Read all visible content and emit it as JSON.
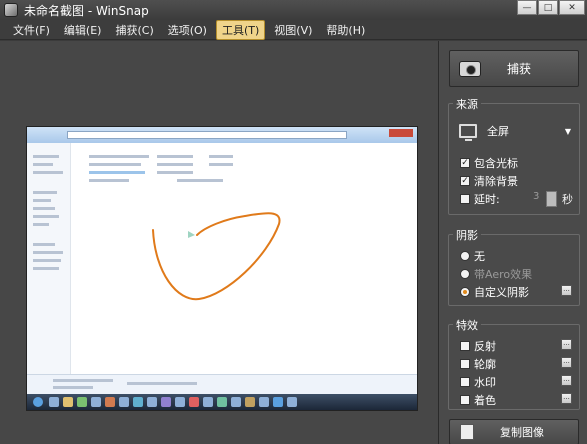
{
  "window": {
    "title": "未命名截图 - WinSnap"
  },
  "menu": [
    "文件(F)",
    "编辑(E)",
    "捕获(C)",
    "选项(O)",
    "工具(T)",
    "视图(V)",
    "帮助(H)"
  ],
  "menu_active_index": 4,
  "panel": {
    "capture_label": "捕获",
    "source": {
      "title": "来源",
      "mode": "全屏",
      "include_cursor": "包含光标",
      "clear_background": "清除背景",
      "delay_label": "延时:",
      "delay_value": "3",
      "delay_unit": "秒"
    },
    "shadow": {
      "title": "阴影",
      "none": "无",
      "aero": "带Aero效果",
      "custom": "自定义阴影"
    },
    "effects": {
      "title": "特效",
      "reflection": "反射",
      "outline": "轮廓",
      "watermark": "水印",
      "tint": "着色"
    },
    "copy_label": "复制图像"
  },
  "colors": {
    "accent": "#f0d48a",
    "scribble": "#e07a1a",
    "panel_bg": "#4a4a4a"
  }
}
